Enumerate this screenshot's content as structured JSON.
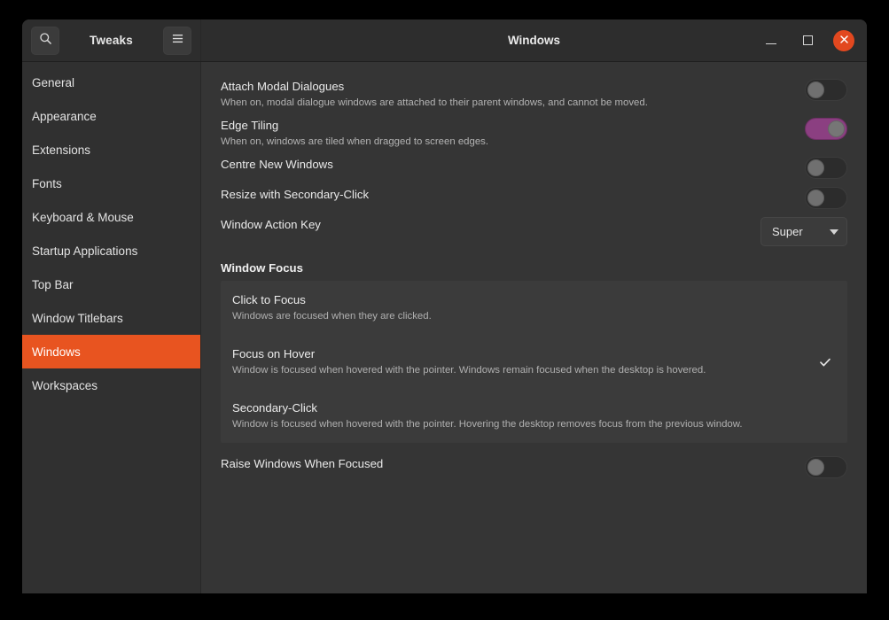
{
  "window": {
    "app_title": "Tweaks",
    "page_title": "Windows",
    "search_icon": "search-icon",
    "menu_icon": "hamburger-menu-icon",
    "minimize_icon": "minimize-icon",
    "maximize_icon": "maximize-icon",
    "close_icon": "close-icon",
    "accent_color": "#e85420",
    "close_button_color": "#e2481f",
    "switch_on_color": "#8b3f81"
  },
  "sidebar": {
    "items": [
      {
        "label": "General",
        "selected": false
      },
      {
        "label": "Appearance",
        "selected": false
      },
      {
        "label": "Extensions",
        "selected": false
      },
      {
        "label": "Fonts",
        "selected": false
      },
      {
        "label": "Keyboard & Mouse",
        "selected": false
      },
      {
        "label": "Startup Applications",
        "selected": false
      },
      {
        "label": "Top Bar",
        "selected": false
      },
      {
        "label": "Window Titlebars",
        "selected": false
      },
      {
        "label": "Windows",
        "selected": true
      },
      {
        "label": "Workspaces",
        "selected": false
      }
    ]
  },
  "main": {
    "rows": [
      {
        "title": "Attach Modal Dialogues",
        "subtitle": "When on, modal dialogue windows are attached to their parent windows, and cannot be moved.",
        "control": "switch",
        "state": "off"
      },
      {
        "title": "Edge Tiling",
        "subtitle": "When on, windows are tiled when dragged to screen edges.",
        "control": "switch",
        "state": "on"
      },
      {
        "title": "Centre New Windows",
        "subtitle": "",
        "control": "switch",
        "state": "off"
      },
      {
        "title": "Resize with Secondary-Click",
        "subtitle": "",
        "control": "switch",
        "state": "off"
      },
      {
        "title": "Window Action Key",
        "subtitle": "",
        "control": "dropdown",
        "value": "Super"
      }
    ],
    "section": {
      "heading": "Window Focus",
      "options": [
        {
          "title": "Click to Focus",
          "subtitle": "Windows are focused when they are clicked.",
          "selected": false
        },
        {
          "title": "Focus on Hover",
          "subtitle": "Window is focused when hovered with the pointer. Windows remain focused when the desktop is hovered.",
          "selected": true
        },
        {
          "title": "Secondary-Click",
          "subtitle": "Window is focused when hovered with the pointer. Hovering the desktop removes focus from the previous window.",
          "selected": false
        }
      ]
    },
    "bottom_row": {
      "title": "Raise Windows When Focused",
      "control": "switch",
      "state": "off"
    }
  }
}
